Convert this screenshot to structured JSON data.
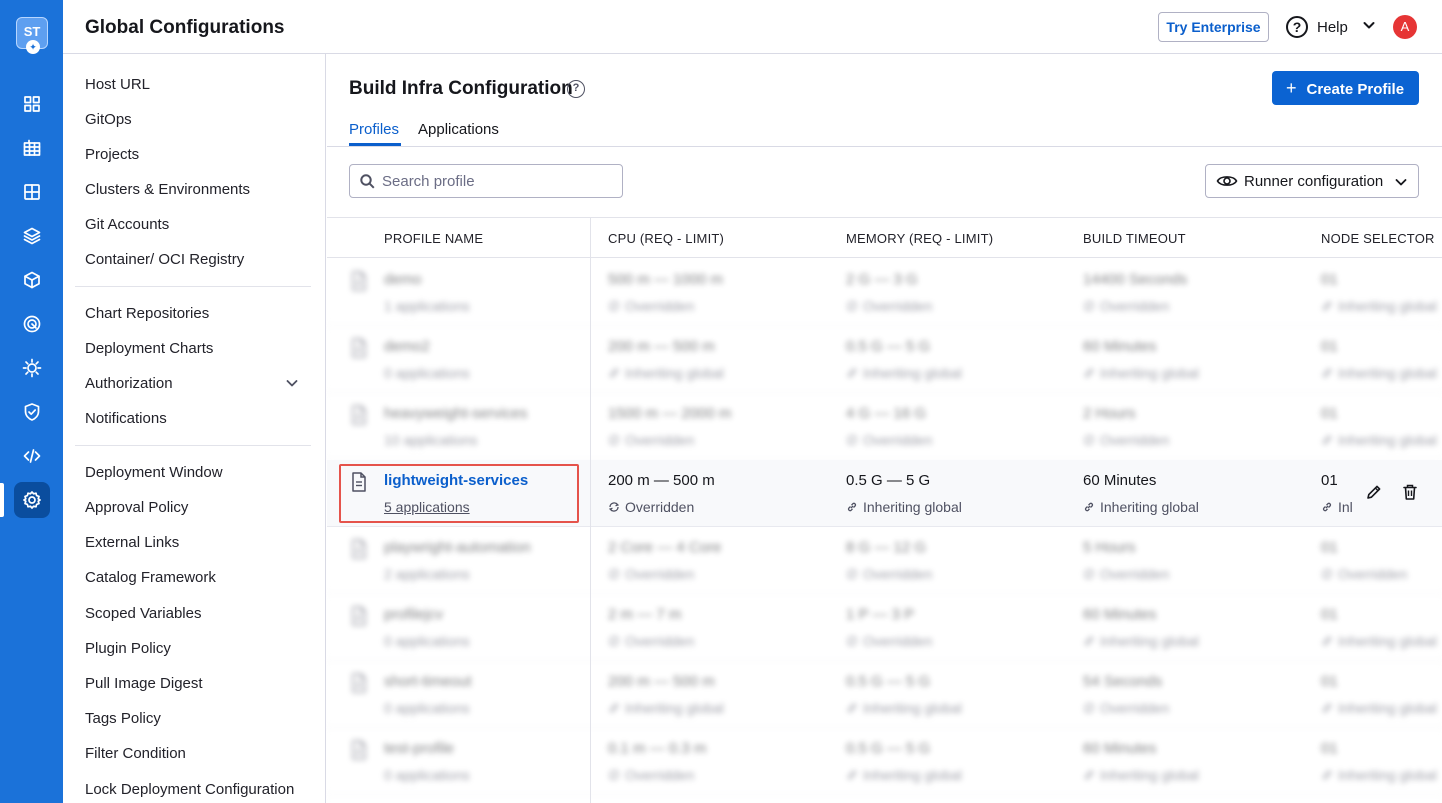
{
  "rail": {
    "logo": "ST",
    "items": [
      "home-icon",
      "dashboards-icon",
      "grid-icon",
      "layers-icon",
      "cube-icon",
      "target-icon",
      "gear-sun-icon",
      "shield-check-icon",
      "code-icon",
      "settings-icon"
    ],
    "accent": "#1b72d9"
  },
  "header": {
    "title": "Global Configurations",
    "try_enterprise": "Try Enterprise",
    "help": "Help",
    "help_icon_glyph": "?",
    "avatar": "A"
  },
  "settings_nav": {
    "items": [
      "Host URL",
      "GitOps",
      "Projects",
      "Clusters & Environments",
      "Git Accounts",
      "Container/ OCI Registry",
      "Chart Repositories",
      "Deployment Charts",
      "Authorization",
      "Notifications",
      "Deployment Window",
      "Approval Policy",
      "External Links",
      "Catalog Framework",
      "Scoped Variables",
      "Plugin Policy",
      "Pull Image Digest",
      "Tags Policy",
      "Filter Condition",
      "Lock Deployment Configuration"
    ]
  },
  "main": {
    "title": "Build Infra Configuration",
    "title_help_glyph": "?",
    "create_button": "Create Profile",
    "create_plus": "+",
    "tabs": [
      "Profiles",
      "Applications"
    ],
    "search_placeholder": "Search profile",
    "runner_button": "Runner configuration",
    "columns": [
      "PROFILE NAME",
      "CPU (REQ - LIMIT)",
      "MEMORY (REQ - LIMIT)",
      "BUILD TIMEOUT",
      "NODE SELECTOR"
    ]
  },
  "rows": [
    {
      "name": "demo",
      "apps": "1 applications",
      "cpu": "500 m — 1000 m",
      "cpu_s": "Overridden",
      "mem": "2 G — 3 G",
      "mem_s": "Overridden",
      "timeout": "14400 Seconds",
      "timeout_s": "Overridden",
      "node": "01",
      "node_s": "Inheriting global",
      "blurred": true
    },
    {
      "name": "demo2",
      "apps": "0 applications",
      "cpu": "200 m — 500 m",
      "cpu_s": "Inheriting global",
      "mem": "0.5 G — 5 G",
      "mem_s": "Inheriting global",
      "timeout": "60 Minutes",
      "timeout_s": "Inheriting global",
      "node": "01",
      "node_s": "Inheriting global",
      "blurred": true
    },
    {
      "name": "heavyweight-services",
      "apps": "10 applications",
      "cpu": "1500 m — 2000 m",
      "cpu_s": "Overridden",
      "mem": "4 G — 16 G",
      "mem_s": "Overridden",
      "timeout": "2 Hours",
      "timeout_s": "Overridden",
      "node": "01",
      "node_s": "Inheriting global",
      "blurred": true
    },
    {
      "name": "lightweight-services",
      "apps": "5 applications",
      "cpu": "200 m — 500 m",
      "cpu_s": "Overridden",
      "mem": "0.5 G — 5 G",
      "mem_s": "Inheriting global",
      "timeout": "60 Minutes",
      "timeout_s": "Inheriting global",
      "node": "01",
      "node_s": "Inl",
      "blurred": false
    },
    {
      "name": "playwright-automation",
      "apps": "2 applications",
      "cpu": "2 Core — 4 Core",
      "cpu_s": "Overridden",
      "mem": "8 G — 12 G",
      "mem_s": "Overridden",
      "timeout": "5 Hours",
      "timeout_s": "Overridden",
      "node": "01",
      "node_s": "Overridden",
      "blurred": true
    },
    {
      "name": "profilejcv",
      "apps": "0 applications",
      "cpu": "2 m — 7 m",
      "cpu_s": "Overridden",
      "mem": "1 P — 3 P",
      "mem_s": "Overridden",
      "timeout": "60 Minutes",
      "timeout_s": "Inheriting global",
      "node": "01",
      "node_s": "Inheriting global",
      "blurred": true
    },
    {
      "name": "short-timeout",
      "apps": "0 applications",
      "cpu": "200 m — 500 m",
      "cpu_s": "Inheriting global",
      "mem": "0.5 G — 5 G",
      "mem_s": "Inheriting global",
      "timeout": "54 Seconds",
      "timeout_s": "Overridden",
      "node": "01",
      "node_s": "Inheriting global",
      "blurred": true
    },
    {
      "name": "test-profile",
      "apps": "0 applications",
      "cpu": "0.1 m — 0.3 m",
      "cpu_s": "Overridden",
      "mem": "0.5 G — 5 G",
      "mem_s": "Inheriting global",
      "timeout": "60 Minutes",
      "timeout_s": "Inheriting global",
      "node": "01",
      "node_s": "Inheriting global",
      "blurred": true
    }
  ],
  "colors": {
    "primary": "#0b63d2",
    "link": "#0b5fcc",
    "highlight_border": "#e5534b"
  }
}
